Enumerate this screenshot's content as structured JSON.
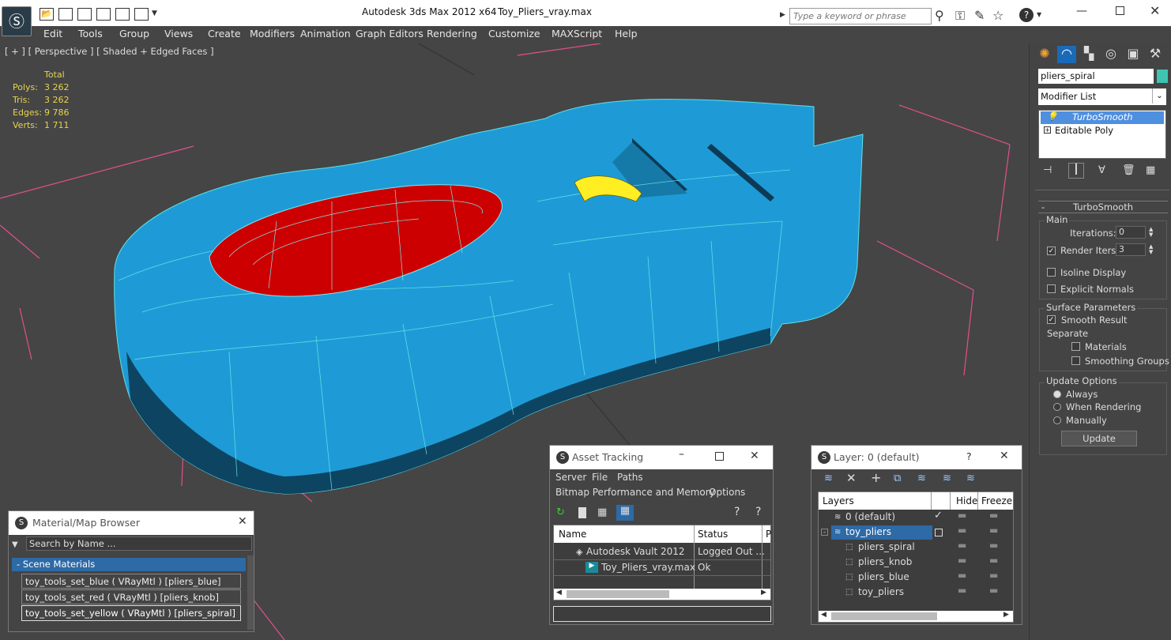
{
  "app": {
    "title": "Autodesk 3ds Max  2012 x64",
    "filename": "Toy_Pliers_vray.max",
    "search_placeholder": "Type a keyword or phrase"
  },
  "menu": [
    "Edit",
    "Tools",
    "Group",
    "Views",
    "Create",
    "Modifiers",
    "Animation",
    "Graph Editors",
    "Rendering",
    "Customize",
    "MAXScript",
    "Help"
  ],
  "viewport": {
    "label": "[ + ] [ Perspective ] [ Shaded + Edged Faces ]",
    "stats_header": "Total",
    "stats": [
      {
        "label": "Polys:",
        "value": "3 262"
      },
      {
        "label": "Tris:",
        "value": "3 262"
      },
      {
        "label": "Edges:",
        "value": "9 786"
      },
      {
        "label": "Verts:",
        "value": "1 711"
      }
    ]
  },
  "command_panel": {
    "object_name": "pliers_spiral",
    "modifier_list": "Modifier List",
    "stack": [
      "TurboSmooth",
      "Editable Poly"
    ],
    "rollout_title": "TurboSmooth",
    "main_label": "Main",
    "iterations_label": "Iterations:",
    "iterations_value": "0",
    "render_iters_label": "Render Iters:",
    "render_iters_value": "3",
    "isoline_label": "Isoline Display",
    "explicit_normals_label": "Explicit Normals",
    "surface_params_label": "Surface Parameters",
    "smooth_result_label": "Smooth Result",
    "separate_label": "Separate",
    "materials_label": "Materials",
    "smoothing_groups_label": "Smoothing Groups",
    "update_options_label": "Update Options",
    "always_label": "Always",
    "when_rendering_label": "When Rendering",
    "manually_label": "Manually",
    "update_button": "Update"
  },
  "material_browser": {
    "title": "Material/Map Browser",
    "search_placeholder": "Search by Name ...",
    "group": "Scene Materials",
    "items": [
      "toy_tools_set_blue ( VRayMtl ) [pliers_blue]",
      "toy_tools_set_red ( VRayMtl ) [pliers_knob]",
      "toy_tools_set_yellow ( VRayMtl ) [pliers_spiral]"
    ]
  },
  "asset_tracking": {
    "title": "Asset Tracking",
    "menu1": [
      "Server",
      "File",
      "Paths"
    ],
    "menu2": [
      "Bitmap Performance and Memory",
      "Options"
    ],
    "col_name": "Name",
    "col_status": "Status",
    "col_p": "P",
    "rows": [
      {
        "name": "Autodesk Vault 2012",
        "status": "Logged Out ..."
      },
      {
        "name": "Toy_Pliers_vray.max",
        "status": "Ok"
      }
    ]
  },
  "layer_dialog": {
    "title": "Layer: 0 (default)",
    "col_layers": "Layers",
    "col_hide": "Hide",
    "col_freeze": "Freeze",
    "rows": [
      "0 (default)",
      "toy_pliers",
      "pliers_spiral",
      "pliers_knob",
      "pliers_blue",
      "toy_pliers"
    ]
  },
  "colors": {
    "accent_blue": "#1ea0d8",
    "selection": "#4f8fe0",
    "stat_yellow": "#e8d34b"
  }
}
